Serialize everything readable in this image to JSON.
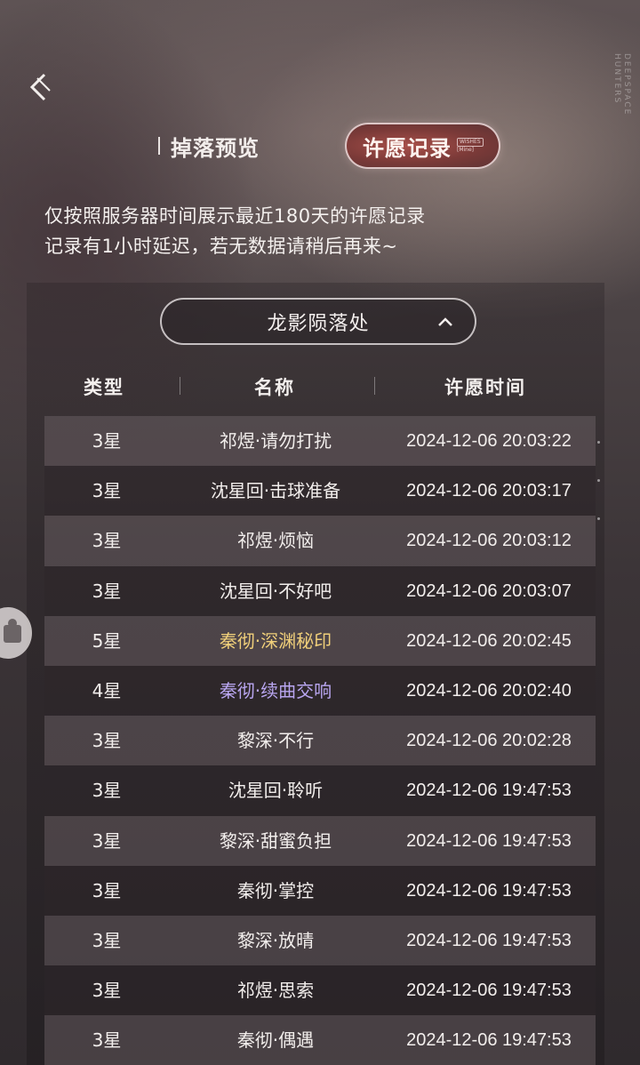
{
  "header": {
    "watermark_line1": "DEEPSPACE",
    "watermark_line2": "HUNTERS"
  },
  "tabs": [
    {
      "label": "掉落预览",
      "active": false
    },
    {
      "label": "许愿记录",
      "active": true,
      "tag_line1": "WISHES",
      "tag_line2": "[Mine]"
    }
  ],
  "notice": {
    "line1": "仅按照服务器时间展示最近180天的许愿记录",
    "line2": "记录有1小时延迟，若无数据请稍后再来~"
  },
  "selector": {
    "label": "龙影陨落处",
    "icon": "chevron-up-icon"
  },
  "table": {
    "headers": {
      "type": "类型",
      "name": "名称",
      "time": "许愿时间"
    },
    "rows": [
      {
        "type": "3星",
        "name": "祁煜·请勿打扰",
        "time": "2024-12-06 20:03:22",
        "color": "#f2eeec"
      },
      {
        "type": "3星",
        "name": "沈星回·击球准备",
        "time": "2024-12-06 20:03:17",
        "color": "#f2eeec"
      },
      {
        "type": "3星",
        "name": "祁煜·烦恼",
        "time": "2024-12-06 20:03:12",
        "color": "#f2eeec"
      },
      {
        "type": "3星",
        "name": "沈星回·不好吧",
        "time": "2024-12-06 20:03:07",
        "color": "#f2eeec"
      },
      {
        "type": "5星",
        "name": "秦彻·深渊秘印",
        "time": "2024-12-06 20:02:45",
        "color": "#f0cf7a"
      },
      {
        "type": "4星",
        "name": "秦彻·续曲交响",
        "time": "2024-12-06 20:02:40",
        "color": "#b9a6f0"
      },
      {
        "type": "3星",
        "name": "黎深·不行",
        "time": "2024-12-06 20:02:28",
        "color": "#f2eeec"
      },
      {
        "type": "3星",
        "name": "沈星回·聆听",
        "time": "2024-12-06 19:47:53",
        "color": "#f2eeec"
      },
      {
        "type": "3星",
        "name": "黎深·甜蜜负担",
        "time": "2024-12-06 19:47:53",
        "color": "#f2eeec"
      },
      {
        "type": "3星",
        "name": "秦彻·掌控",
        "time": "2024-12-06 19:47:53",
        "color": "#f2eeec"
      },
      {
        "type": "3星",
        "name": "黎深·放晴",
        "time": "2024-12-06 19:47:53",
        "color": "#f2eeec"
      },
      {
        "type": "3星",
        "name": "祁煜·思索",
        "time": "2024-12-06 19:47:53",
        "color": "#f2eeec"
      },
      {
        "type": "3星",
        "name": "秦彻·偶遇",
        "time": "2024-12-06 19:47:53",
        "color": "#f2eeec"
      }
    ]
  }
}
